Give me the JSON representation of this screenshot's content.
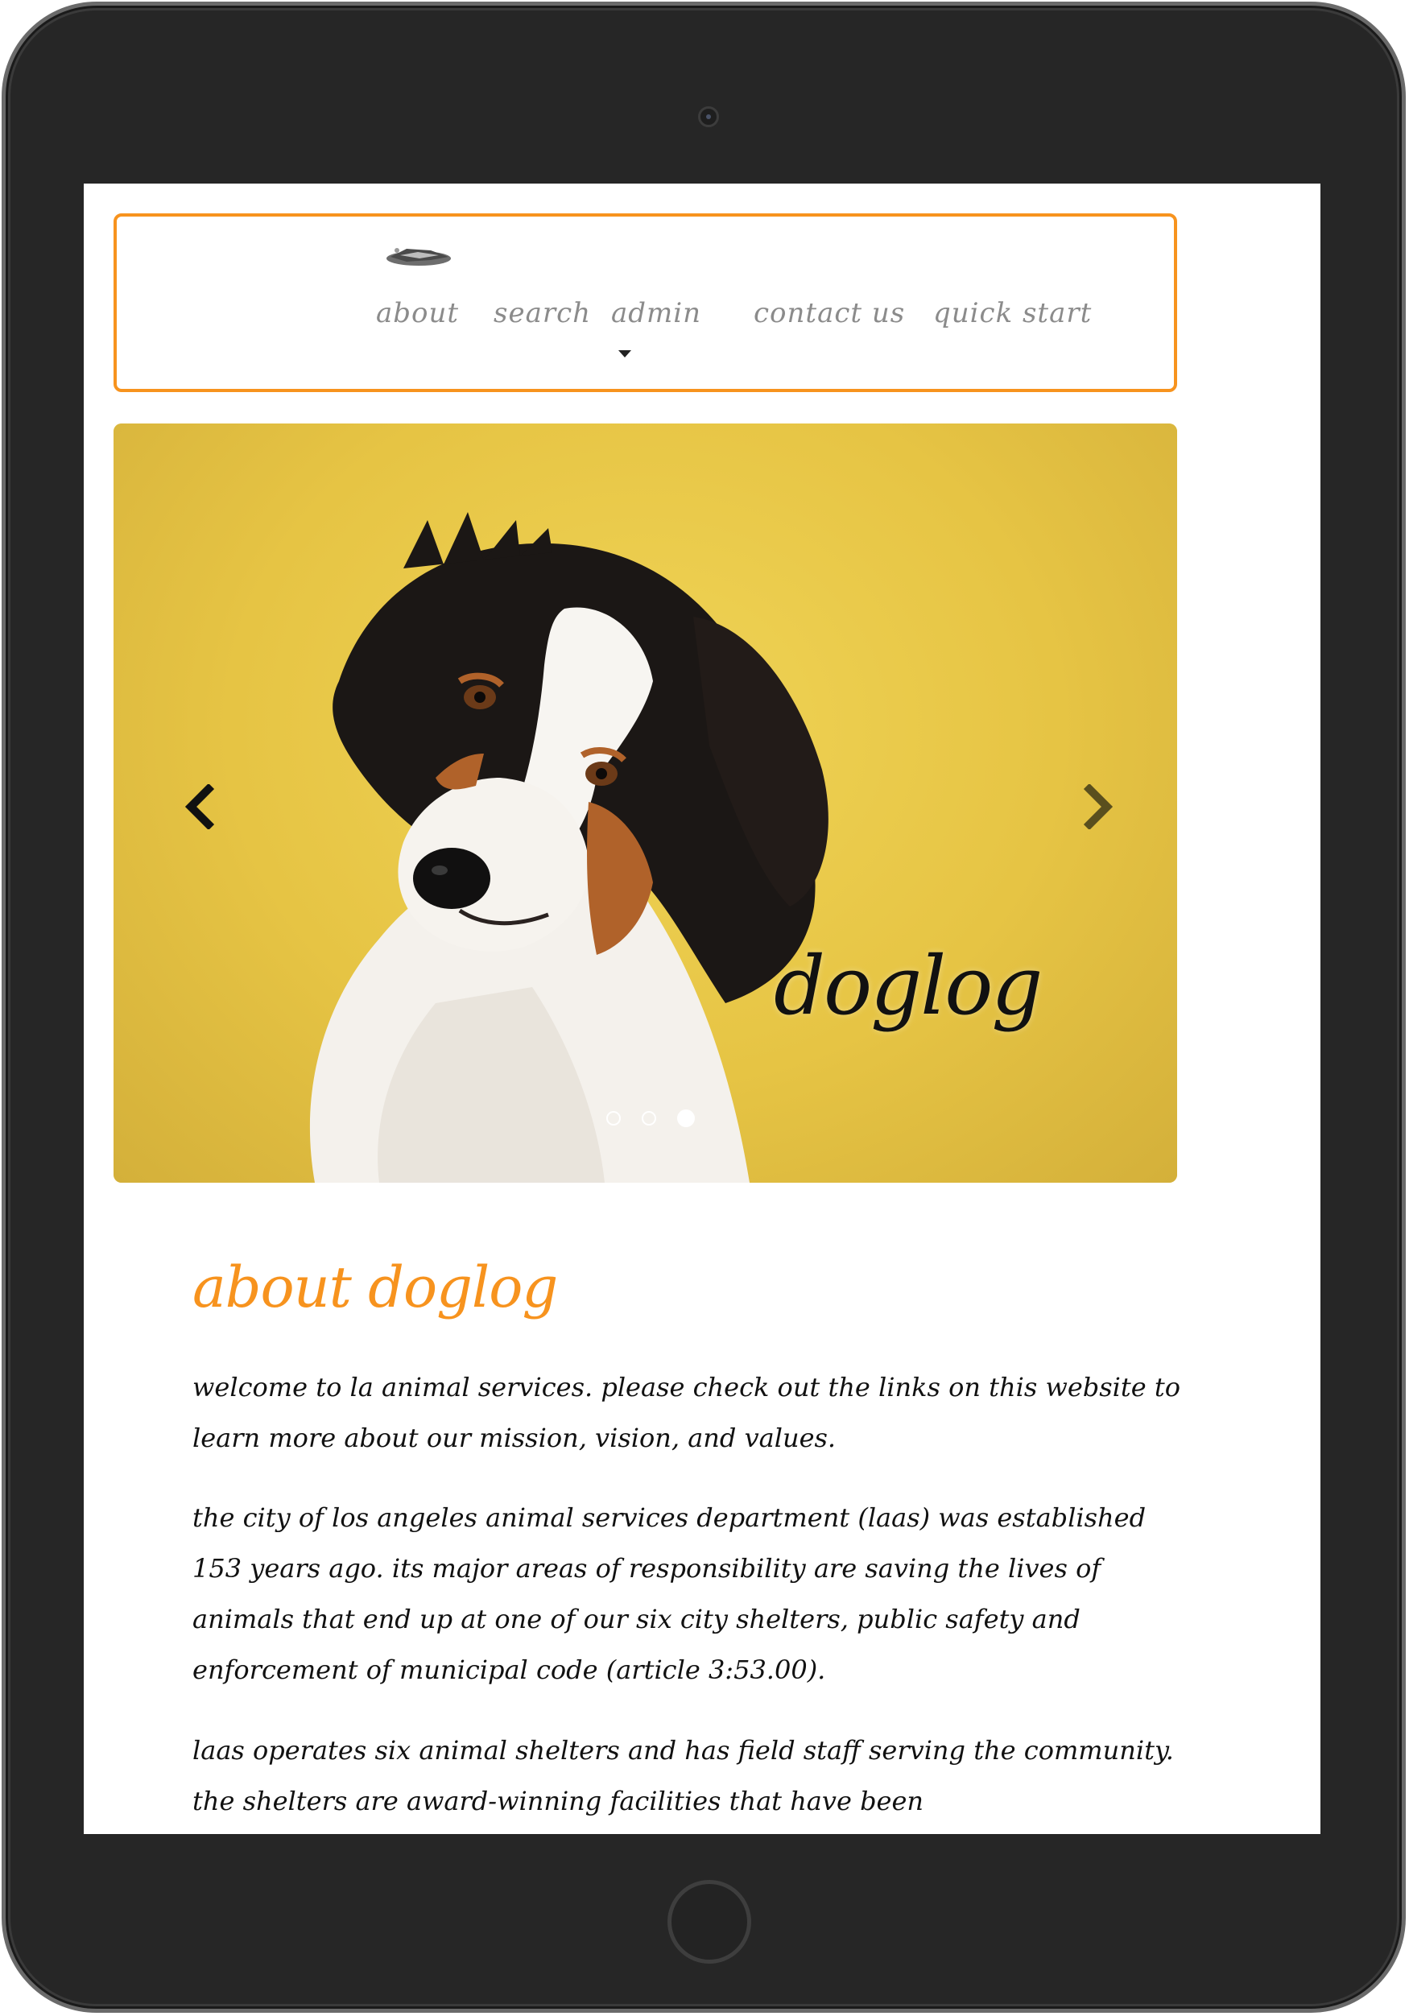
{
  "nav": {
    "items": [
      {
        "label": "about"
      },
      {
        "label": "search"
      },
      {
        "label": "admin"
      },
      {
        "label": "contact us"
      },
      {
        "label": "quick start"
      }
    ]
  },
  "carousel": {
    "caption": "doglog",
    "slide_count": 3,
    "active_slide_index": 2,
    "background_color": "#e6c444"
  },
  "about": {
    "title": "about doglog",
    "paragraphs": [
      "welcome to la animal services. please check out the links on this website to learn more about our mission, vision, and values.",
      "the city of los angeles animal services department (laas) was established 153 years ago. its major areas of responsibility are saving the lives of animals that end up at one of our six city shelters, public safety and enforcement of municipal code (article 3:53.00).",
      "laas operates six animal shelters and has field staff serving the community. the shelters are award-winning facilities that have been"
    ]
  },
  "theme": {
    "accent": "#f7931e",
    "nav_text": "#8b8b8b",
    "body_text": "#111111"
  },
  "icons": [
    "chevron-left-icon",
    "chevron-right-icon",
    "caret-down-icon",
    "logo-icon"
  ]
}
